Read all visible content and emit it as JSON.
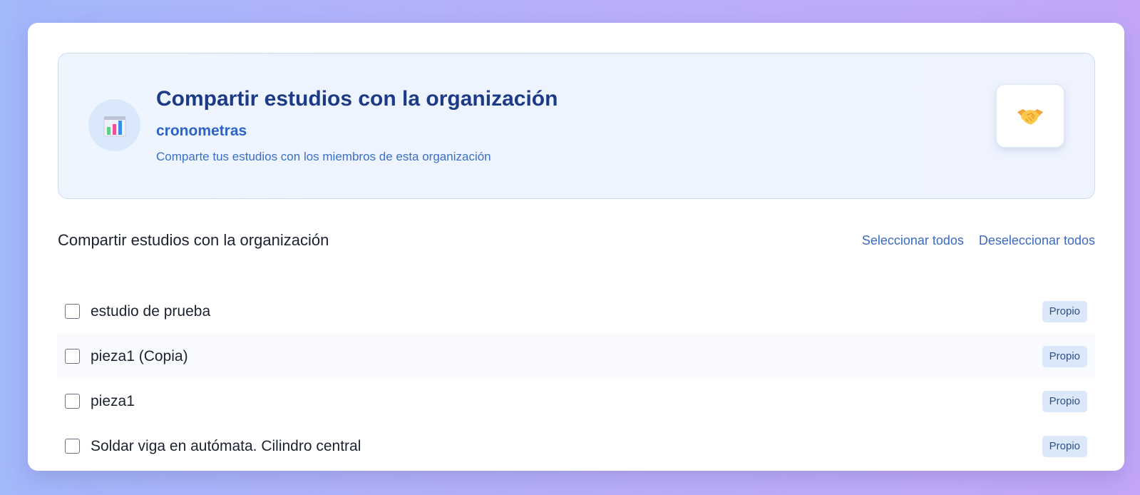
{
  "header": {
    "title": "Compartir estudios con la organización",
    "organization": "cronometras",
    "description": "Comparte tus estudios con los miembros de esta organización",
    "icon": "bar-chart-icon",
    "badge_icon": "handshake-icon"
  },
  "section": {
    "title": "Compartir estudios con la organización",
    "select_all_label": "Seleccionar todos",
    "deselect_all_label": "Deseleccionar todos"
  },
  "studies": [
    {
      "name": "estudio de prueba",
      "tag": "Propio",
      "checked": false
    },
    {
      "name": "pieza1 (Copia)",
      "tag": "Propio",
      "checked": false
    },
    {
      "name": "pieza1",
      "tag": "Propio",
      "checked": false
    },
    {
      "name": "Soldar viga en autómata. Cilindro central",
      "tag": "Propio",
      "checked": false
    }
  ],
  "colors": {
    "title": "#1c3a86",
    "accent": "#2c63c8",
    "link": "#3b6ac0",
    "tag_bg": "#dbe8f9"
  }
}
